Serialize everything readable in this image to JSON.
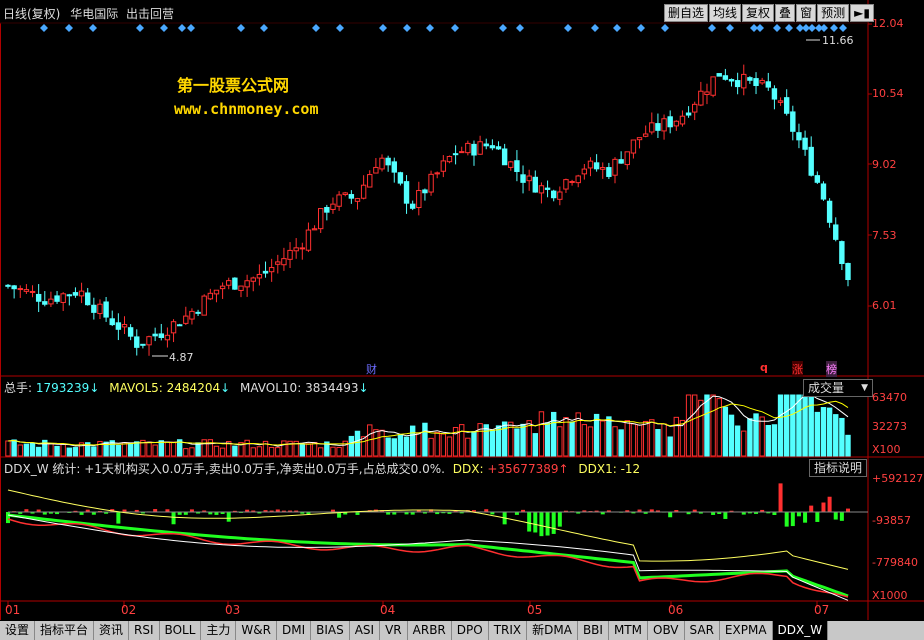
{
  "header": {
    "period": "日线(复权)",
    "stock_name": "华电国际",
    "mode": "出击回营",
    "toolbar": [
      "删自选",
      "均线",
      "复权",
      "叠",
      "窗",
      "预测"
    ]
  },
  "watermark": {
    "line1": "第一股票公式网",
    "line2": "www.chnmoney.com"
  },
  "colors": {
    "up": "#ff3030",
    "down": "#54ffff",
    "bg": "#000000",
    "axis": "#b00000",
    "yellow": "#ffff00"
  },
  "price_axis": {
    "labels": [
      "12.04",
      "10.54",
      "9.02",
      "7.53",
      "6.01"
    ]
  },
  "volume_axis": {
    "labels": [
      "63470",
      "32273",
      "X100"
    ]
  },
  "ddx_axis": {
    "labels": [
      "+592127",
      "-93857",
      "-779840",
      "X1000"
    ]
  },
  "time_axis": {
    "labels": [
      "01",
      "02",
      "03",
      "04",
      "05",
      "06",
      "07"
    ]
  },
  "annotations": {
    "high": "11.66",
    "low": "4.87",
    "marker_cai": "财",
    "marker_q": "q",
    "marker_zhang": "涨",
    "marker_bang": "榜"
  },
  "volume_info": {
    "total_label": "总手:",
    "total_value": "1793239",
    "mavol5_label": "MAVOL5:",
    "mavol5_value": "2484204",
    "mavol10_label": "MAVOL10:",
    "mavol10_value": "3834493",
    "selector": "成交量"
  },
  "ddx_info": {
    "stats": "DDX_W 统计: +1天机构买入0.0万手,卖出0.0万手,净卖出0.0万手,占总成交0.0%.",
    "ddx_label": "DDX:",
    "ddx_value": "+35677389",
    "ddx1_label": "DDX1:",
    "ddx1_value": "-12",
    "help_button": "指标说明"
  },
  "bottom_tabs": [
    "设置",
    "指标平台",
    "资讯",
    "RSI",
    "BOLL",
    "主力",
    "W&R",
    "DMI",
    "BIAS",
    "ASI",
    "VR",
    "ARBR",
    "DPO",
    "TRIX",
    "新DMA",
    "BBI",
    "MTM",
    "OBV",
    "SAR",
    "EXPMA",
    "DDX_W"
  ],
  "chart_data": {
    "type": "candlestick",
    "price_range": [
      4.5,
      12.3
    ],
    "start_close": 6.4,
    "high_point": 11.66,
    "low_point": 4.87,
    "end_close": 6.6
  }
}
